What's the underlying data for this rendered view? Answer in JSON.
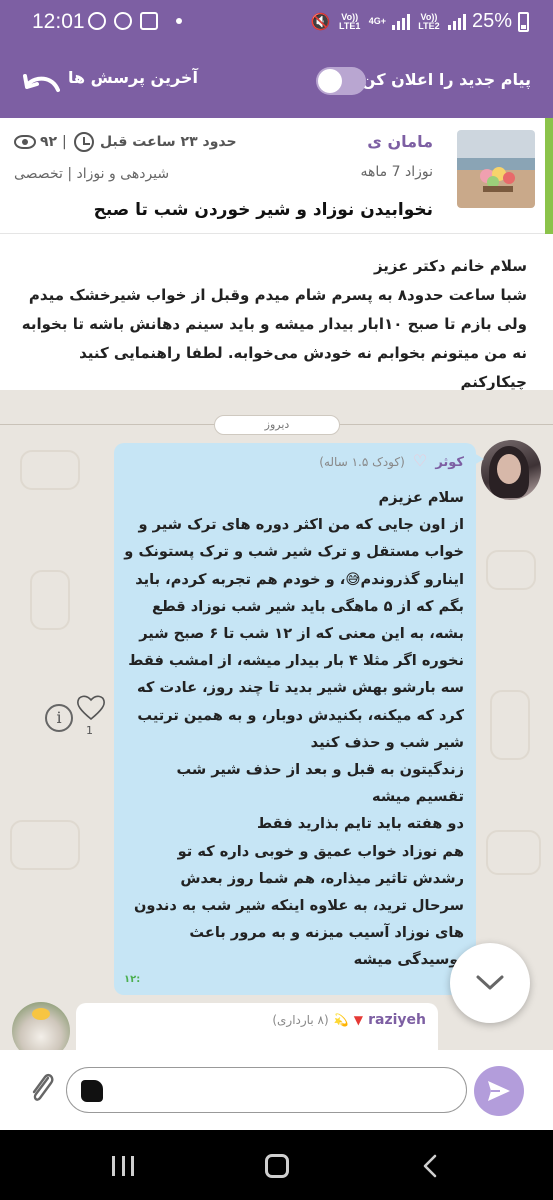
{
  "status_bar": {
    "time": "12:01",
    "battery": "25%",
    "sim1_label": "Vo)) LTE1",
    "sim2_label": "Vo)) LTE2",
    "net_label": "4G+"
  },
  "top_bar": {
    "notify_label": "پیام جدید را اعلان کن",
    "latest_label": "آخرین پرسش ها"
  },
  "question": {
    "author": "مامان ی",
    "child_age": "نوزاد 7 ماهه",
    "time_ago": "حدود ۲۳ ساعت قبل",
    "views": "۹۲",
    "separator": "|",
    "tags": "شیردهی و نوزاد | تخصصی",
    "title": "نخوابیدن نوزاد و شیر خوردن شب تا صبح",
    "body": [
      "سلام خانم دکتر عزیز",
      "شبا ساعت حدود۸ به پسرم شام میدم وقبل از خواب شیرخشک میدم ولی بازم تا صبح ۱۰ابار بیدار میشه و باید سینم دهانش باشه تا بخوابه نه من میتونم بخوابم نه خودش می‌خوابه. لطفا راهنمایی کنید چیکارکنم"
    ]
  },
  "chat": {
    "date_divider": "دیروز",
    "reply": {
      "name": "کوثر",
      "heart": "♡",
      "sub": "(کودک ۱.۵ ساله)",
      "lines": [
        "سلام عزیزم",
        "از اون جایی که من اکثر دوره های ترک شیر و خواب مستقل و ترک شیر شب و ترک پستونک و اینارو گذروندم😅، و خودم هم تجربه کردم، باید بگم که از ۵ ماهگی باید شیر شب نوزاد قطع بشه، به این معنی که از ۱۲ شب تا ۶ صبح شیر نخوره اگر مثلا ۴ بار بیدار میشه، از امشب فقط سه بارشو بهش شیر بدید تا چند روز، عادت که کرد که میکنه، بکنیدش دوبار، و به همین ترتیب شیر شب و حذف کنید",
        "زندگیتون به قبل و بعد از حذف شیر شب تقسیم میشه",
        "دو هفته باید تایم بذارید فقط",
        "هم نوزاد خواب عمیق و خوبی داره که تو رشدش تاثیر میذاره، هم شما روز بعدش سرحال ترید، به علاوه اینکه شیر شب به دندون های نوزاد آسیب میزنه و به مرور باعث پوسیدگی میشه"
      ],
      "time": "۱۲:",
      "likes": "1"
    },
    "next_reply": {
      "name": "raziyeh",
      "sub": "(۸ بارداری)",
      "emoji": "💫"
    }
  },
  "composer": {
    "placeholder": ""
  },
  "colors": {
    "brand": "#7d5fa3",
    "bubble": "#c6e5f5",
    "accent_green": "#8bc34a"
  }
}
